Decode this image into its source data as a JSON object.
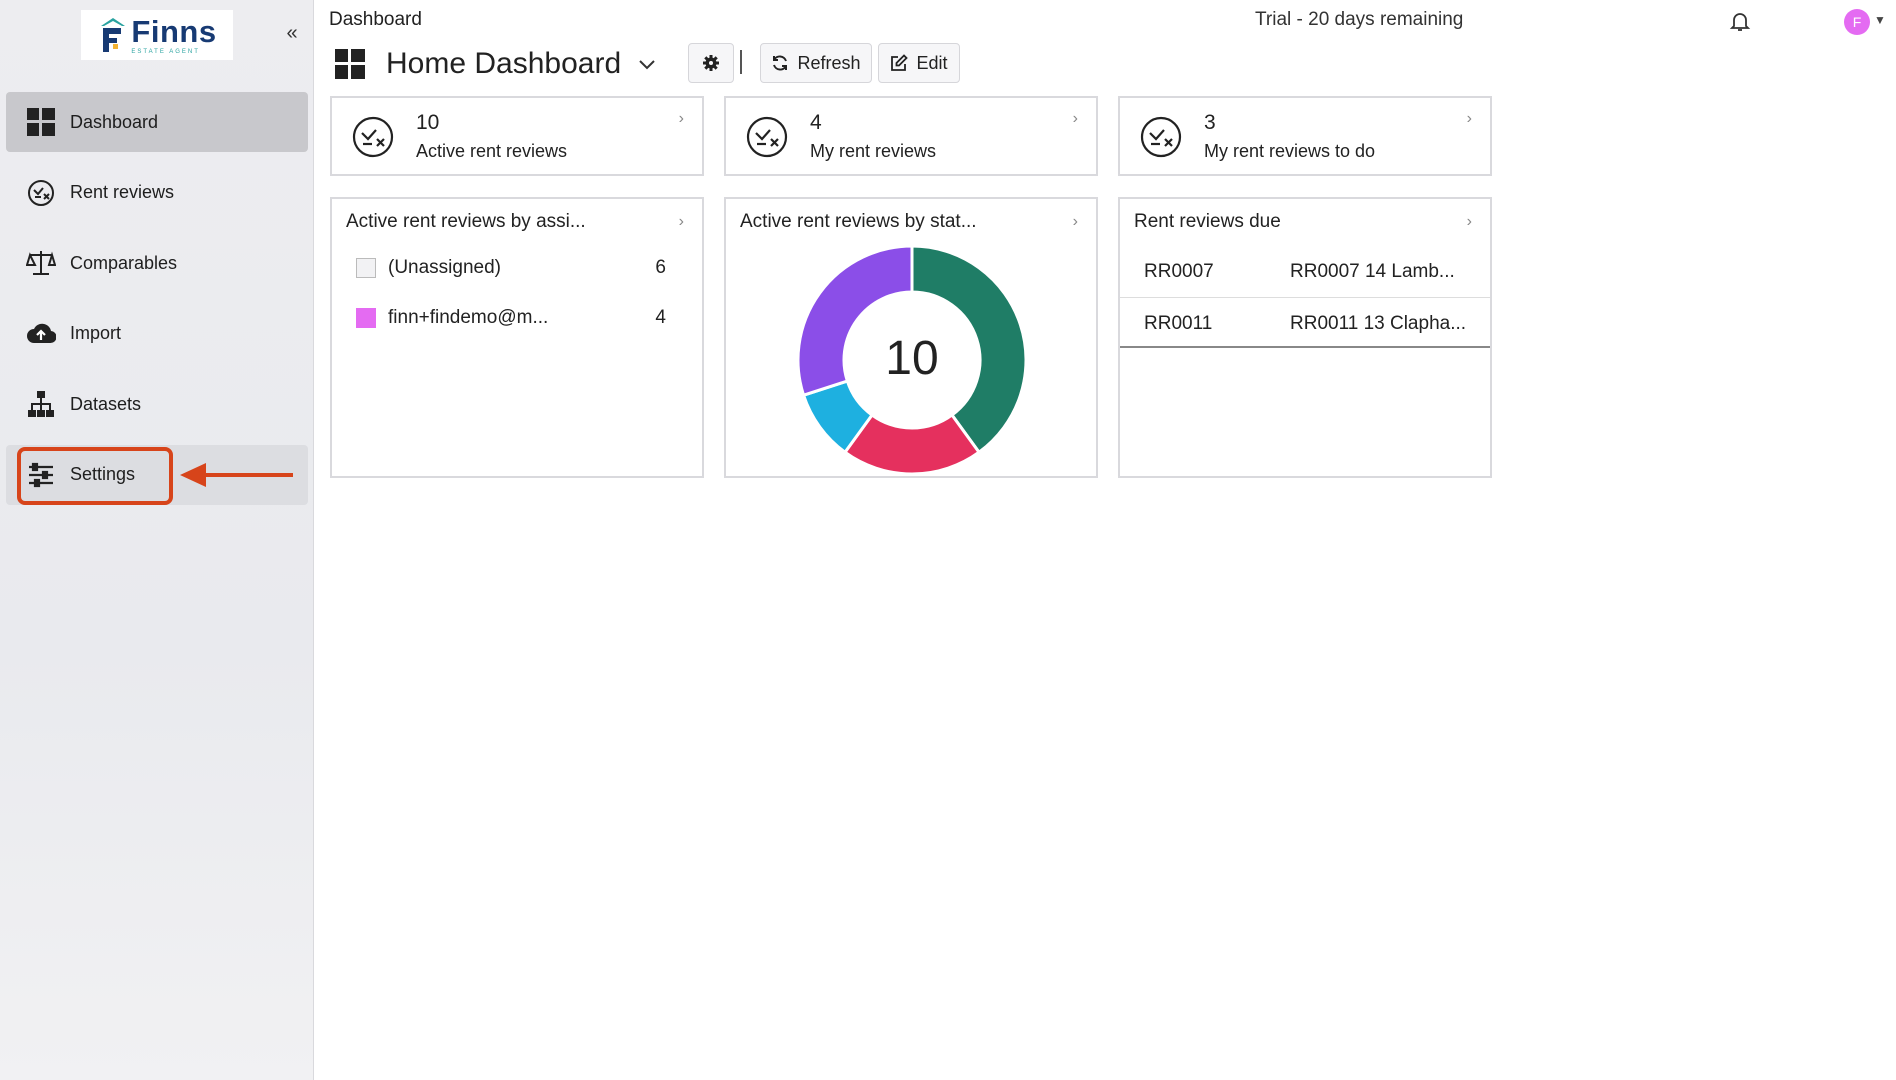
{
  "app": {
    "logo_name": "Finns",
    "logo_sub": "ESTATE AGENT",
    "collapse_glyph": "«"
  },
  "sidebar": {
    "items": [
      {
        "label": "Dashboard",
        "icon": "dashboard-grid-icon",
        "active": true
      },
      {
        "label": "Rent reviews",
        "icon": "rent-review-icon"
      },
      {
        "label": "Comparables",
        "icon": "scales-icon"
      },
      {
        "label": "Import",
        "icon": "cloud-upload-icon"
      },
      {
        "label": "Datasets",
        "icon": "hierarchy-icon"
      },
      {
        "label": "Settings",
        "icon": "sliders-icon",
        "highlighted": true
      }
    ]
  },
  "header": {
    "breadcrumb": "Dashboard",
    "trial": "Trial - 20 days remaining",
    "avatar_initial": "F",
    "title": "Home Dashboard",
    "refresh_label": "Refresh",
    "edit_label": "Edit"
  },
  "stats": [
    {
      "value": "10",
      "label": "Active rent reviews"
    },
    {
      "value": "4",
      "label": "My rent reviews"
    },
    {
      "value": "3",
      "label": "My rent reviews to do"
    }
  ],
  "widgets": {
    "by_assignee": {
      "title": "Active rent reviews by assi...",
      "rows": [
        {
          "label": "(Unassigned)",
          "count": "6",
          "color": "#f2f2f4"
        },
        {
          "label": "finn+findemo@m...",
          "count": "4",
          "color": "#e46bf2"
        }
      ]
    },
    "by_status": {
      "title": "Active rent reviews by stat...",
      "center_value": "10"
    },
    "due": {
      "title": "Rent reviews due",
      "rows": [
        {
          "id": "RR0007",
          "desc": "RR0007 14 Lamb..."
        },
        {
          "id": "RR0011",
          "desc": "RR0011 13 Clapha..."
        }
      ]
    }
  },
  "chart_data": {
    "type": "pie",
    "donut": true,
    "center_label": "10",
    "slices": [
      {
        "value": 4,
        "color": "#1f7d66"
      },
      {
        "value": 2,
        "color": "#e5305e"
      },
      {
        "value": 1,
        "color": "#1eb0e0"
      },
      {
        "value": 3,
        "color": "#8b4ee8"
      }
    ]
  }
}
